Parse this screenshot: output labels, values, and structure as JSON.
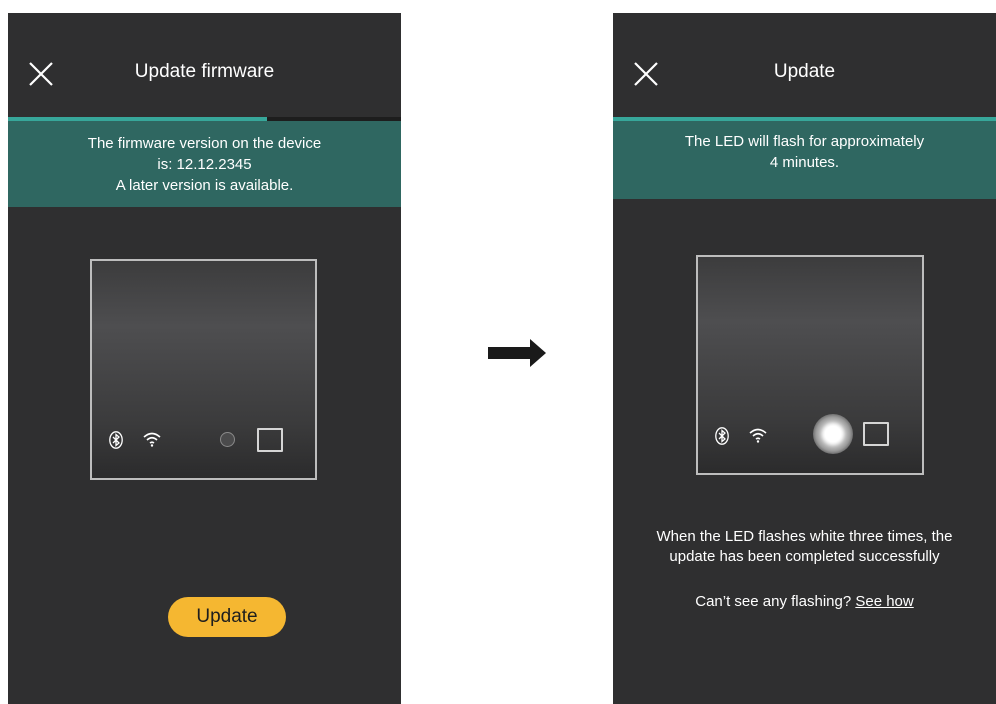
{
  "left_screen": {
    "title": "Update firmware",
    "progress_percent": 66,
    "banner_lines": [
      "The firmware version on the device",
      "is: 12.12.2345",
      "A later version is available."
    ],
    "update_button_label": "Update"
  },
  "right_screen": {
    "title": "Update",
    "progress_percent": 100,
    "banner_lines": [
      "The LED will flash for approximately",
      "4 minutes."
    ],
    "info_lines": [
      "When the LED flashes white three times, the",
      "update has been completed successfully"
    ],
    "help_prompt": "Can’t see any flashing?",
    "help_link": "See how"
  },
  "colors": {
    "screen_bg": "#2f2f30",
    "banner_bg": "#2f6761",
    "progress_accent": "#37a79a",
    "button_bg": "#f5b731"
  },
  "icons": [
    "close-icon",
    "bluetooth-icon",
    "wifi-icon",
    "led-indicator",
    "arrow-right-icon"
  ]
}
